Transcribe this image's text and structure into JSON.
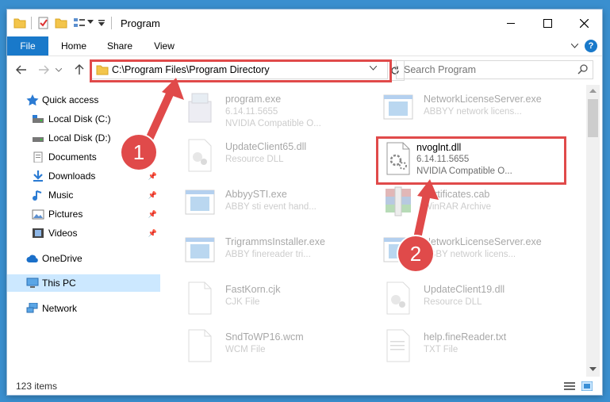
{
  "window": {
    "title": "Program"
  },
  "ribbon": {
    "tabs": [
      "File",
      "Home",
      "Share",
      "View"
    ],
    "help": "?"
  },
  "address": {
    "path": "C:\\Program Files\\Program Directory"
  },
  "search": {
    "placeholder": "Search Program"
  },
  "sidebar": {
    "items": [
      {
        "label": "Quick access",
        "icon": "star-icon"
      },
      {
        "label": "Local Disk (C:)",
        "icon": "drive-icon"
      },
      {
        "label": "Local Disk (D:)",
        "icon": "drive-icon"
      },
      {
        "label": "Documents",
        "icon": "documents-icon"
      },
      {
        "label": "Downloads",
        "icon": "download-icon"
      },
      {
        "label": "Music",
        "icon": "music-icon"
      },
      {
        "label": "Pictures",
        "icon": "pictures-icon"
      },
      {
        "label": "Videos",
        "icon": "videos-icon"
      },
      {
        "label": "OneDrive",
        "icon": "cloud-icon"
      },
      {
        "label": "This PC",
        "icon": "computer-icon"
      },
      {
        "label": "Network",
        "icon": "network-icon"
      }
    ]
  },
  "files": [
    {
      "name": "program.exe",
      "line2": "6.14.11.5655",
      "line3": "NVIDIA Compatible O..."
    },
    {
      "name": "NetworkLicenseServer.exe",
      "line2": "ABBYY network licens...",
      "line3": ""
    },
    {
      "name": "UpdateClient65.dll",
      "line2": "Resource DLL",
      "line3": ""
    },
    {
      "name": "nvoglnt.dll",
      "line2": "6.14.11.5655",
      "line3": "NVIDIA Compatible O..."
    },
    {
      "name": "AbbyySTI.exe",
      "line2": "ABBY sti event hand...",
      "line3": ""
    },
    {
      "name": "certificates.cab",
      "line2": "WinRAR Archive",
      "line3": ""
    },
    {
      "name": "TrigrammsInstaller.exe",
      "line2": "ABBY finereader tri...",
      "line3": ""
    },
    {
      "name": "NetworkLicenseServer.exe",
      "line2": "ABBY network licens...",
      "line3": ""
    },
    {
      "name": "FastKorn.cjk",
      "line2": "CJK File",
      "line3": ""
    },
    {
      "name": "UpdateClient19.dll",
      "line2": "Resource DLL",
      "line3": ""
    },
    {
      "name": "SndToWP16.wcm",
      "line2": "WCM File",
      "line3": ""
    },
    {
      "name": "help.fineReader.txt",
      "line2": "TXT File",
      "line3": ""
    }
  ],
  "status": {
    "count": "123 items"
  },
  "annotations": {
    "step1": "1",
    "step2": "2"
  },
  "colors": {
    "accent": "#1979ca",
    "highlight": "#e04a4a",
    "selected": "#cce8ff"
  }
}
